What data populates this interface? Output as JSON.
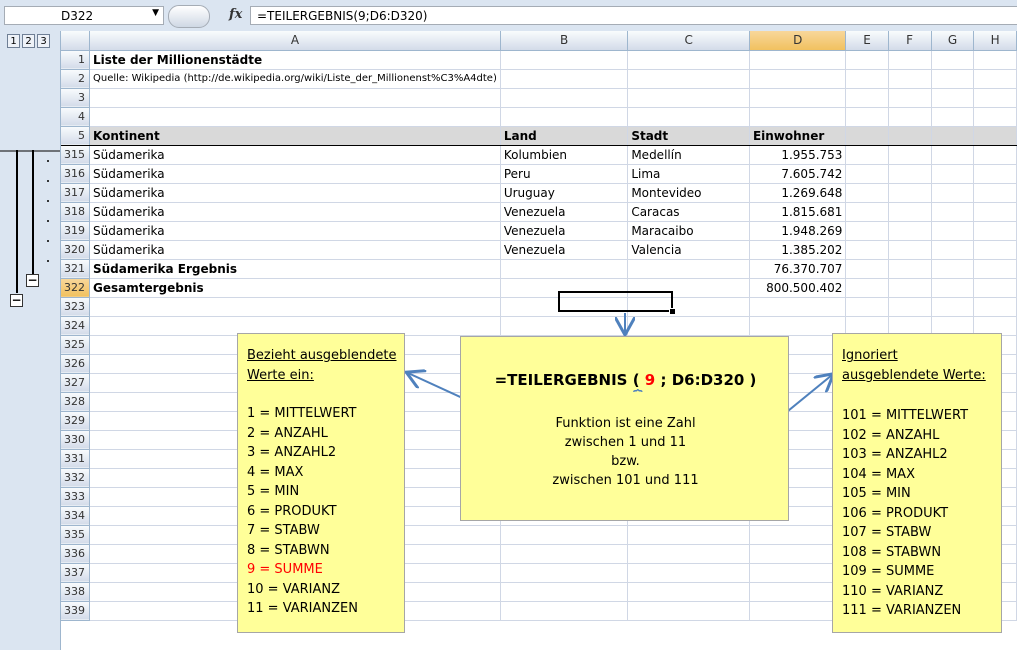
{
  "formula_bar": {
    "name_box": "D322",
    "fx": "fx",
    "formula": "=TEILERGEBNIS(9;D6:D320)"
  },
  "outline": {
    "levels": [
      "1",
      "2",
      "3"
    ],
    "collapse_symbol": "−"
  },
  "columns": [
    "A",
    "B",
    "C",
    "D",
    "E",
    "F",
    "G",
    "H"
  ],
  "rows": [
    {
      "n": "1",
      "a": "Liste der Millionenstädte",
      "b": "",
      "c": "",
      "d": ""
    },
    {
      "n": "2",
      "a": "Quelle: Wikipedia (http://de.wikipedia.org/wiki/Liste_der_Millionenst%C3%A4dte)",
      "b": "",
      "c": "",
      "d": ""
    },
    {
      "n": "3",
      "a": "",
      "b": "",
      "c": "",
      "d": ""
    },
    {
      "n": "4",
      "a": "",
      "b": "",
      "c": "",
      "d": ""
    },
    {
      "n": "5",
      "a": "Kontinent",
      "b": "Land",
      "c": "Stadt",
      "d": "Einwohner"
    },
    {
      "n": "315",
      "a": "Südamerika",
      "b": "Kolumbien",
      "c": "Medellín",
      "d": "1.955.753"
    },
    {
      "n": "316",
      "a": "Südamerika",
      "b": "Peru",
      "c": "Lima",
      "d": "7.605.742"
    },
    {
      "n": "317",
      "a": "Südamerika",
      "b": "Uruguay",
      "c": "Montevideo",
      "d": "1.269.648"
    },
    {
      "n": "318",
      "a": "Südamerika",
      "b": "Venezuela",
      "c": "Caracas",
      "d": "1.815.681"
    },
    {
      "n": "319",
      "a": "Südamerika",
      "b": "Venezuela",
      "c": "Maracaibo",
      "d": "1.948.269"
    },
    {
      "n": "320",
      "a": "Südamerika",
      "b": "Venezuela",
      "c": "Valencia",
      "d": "1.385.202"
    },
    {
      "n": "321",
      "a": "Südamerika Ergebnis",
      "b": "",
      "c": "",
      "d": "76.370.707"
    },
    {
      "n": "322",
      "a": "Gesamtergebnis",
      "b": "",
      "c": "",
      "d": "800.500.402"
    },
    {
      "n": "323"
    },
    {
      "n": "324"
    },
    {
      "n": "325"
    },
    {
      "n": "326"
    },
    {
      "n": "327"
    },
    {
      "n": "328"
    },
    {
      "n": "329"
    },
    {
      "n": "330"
    },
    {
      "n": "331"
    },
    {
      "n": "332"
    },
    {
      "n": "333"
    },
    {
      "n": "334"
    },
    {
      "n": "335"
    },
    {
      "n": "336"
    },
    {
      "n": "337"
    },
    {
      "n": "338"
    },
    {
      "n": "339"
    }
  ],
  "note_left": {
    "title1": "Bezieht ausgeblendete",
    "title2": "Werte ein:",
    "items": [
      "1 = MITTELWERT",
      "2 = ANZAHL",
      "3 = ANZAHL2",
      "4 = MAX",
      "5 = MIN",
      "6 = PRODUKT",
      "7 = STABW",
      "8 = STABWN",
      "9 = SUMME",
      "10 = VARIANZ",
      "11 = VARIANZEN"
    ],
    "highlight_color": "#ff0000"
  },
  "note_center": {
    "f_prefix": "=TEILERGEBNIS (",
    "f_num": "9",
    "f_suffix": "; D6:D320 )",
    "brace": "⏟",
    "desc": [
      "Funktion ist eine Zahl",
      "zwischen 1 und 11",
      "bzw.",
      "zwischen 101 und 111"
    ]
  },
  "note_right": {
    "title1": "Ignoriert",
    "title2": "ausgeblendete Werte:",
    "items": [
      "101 = MITTELWERT",
      "102 = ANZAHL",
      "103 = ANZAHL2",
      "104 = MAX",
      "105 = MIN",
      "106 = PRODUKT",
      "107 = STABW",
      "108 = STABWN",
      "109 = SUMME",
      "110 = VARIANZ",
      "111 = VARIANZEN"
    ]
  },
  "colors": {
    "note_bg": "#ffff99",
    "arrow": "#4f81bd",
    "header_bg": "#dbe5f1",
    "selected_header": "#f1c15f"
  }
}
